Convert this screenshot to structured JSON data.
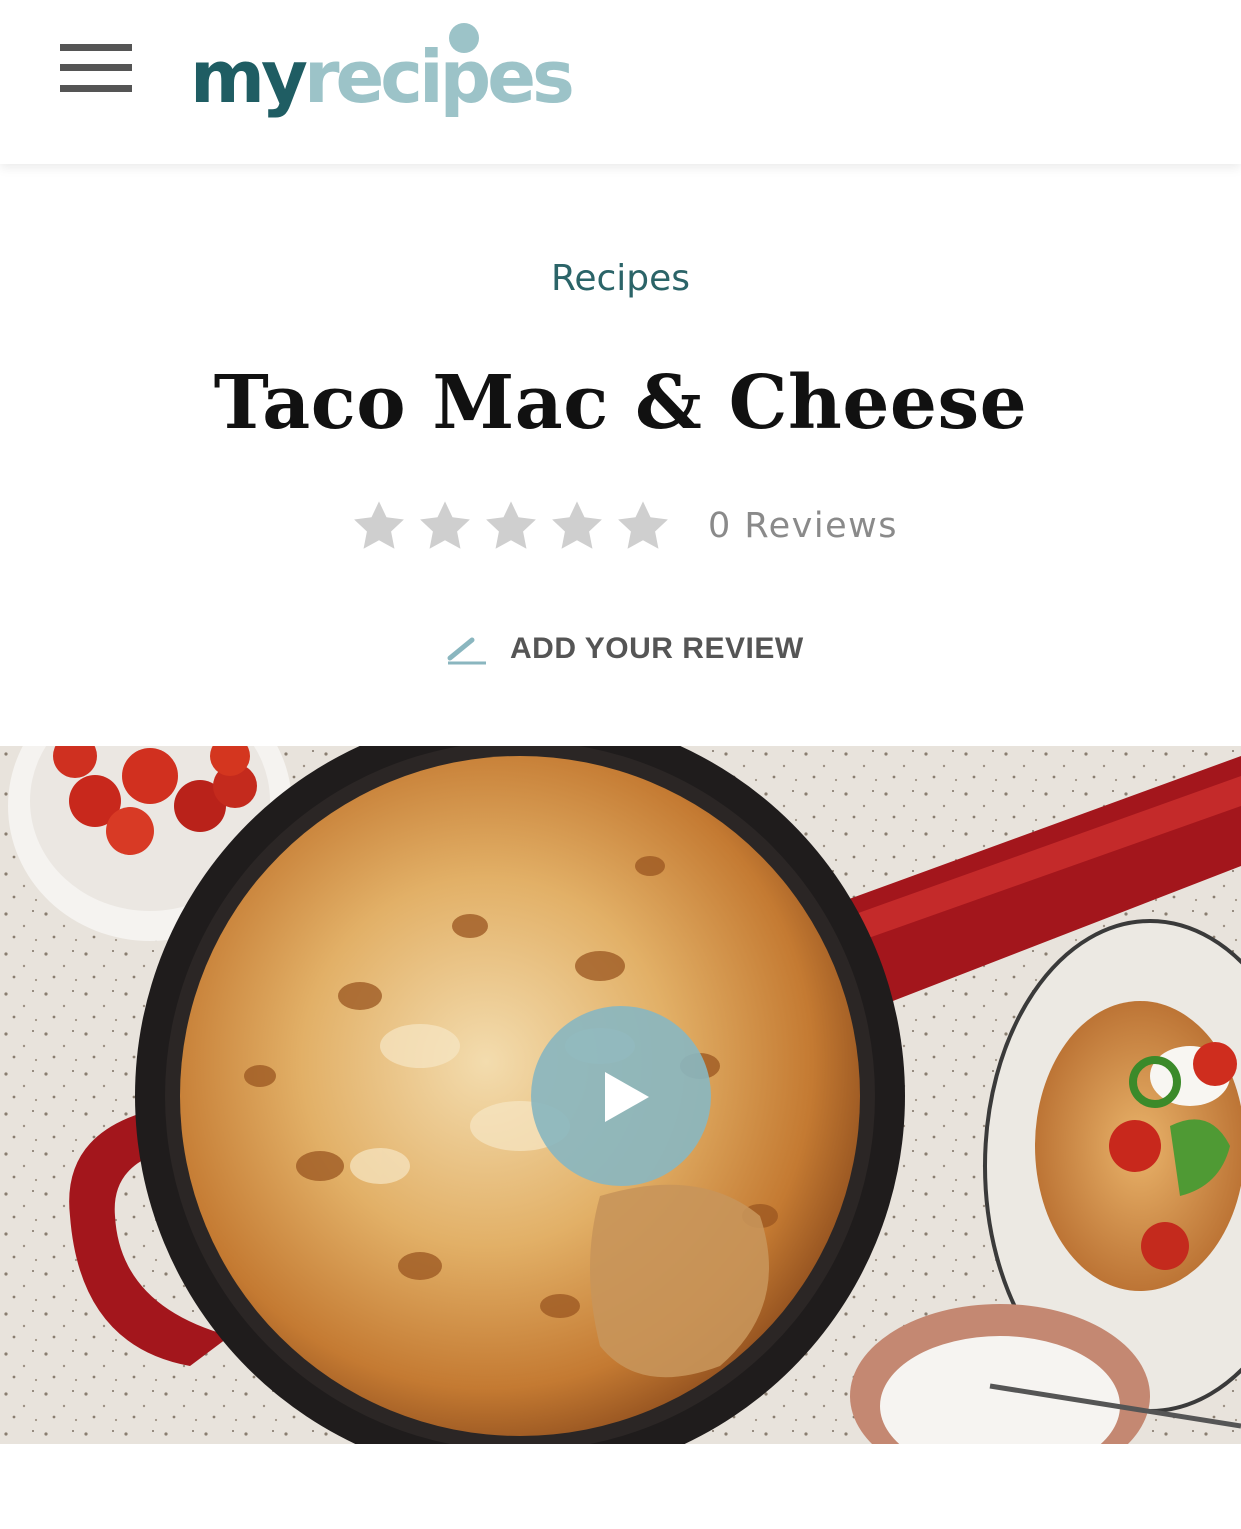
{
  "header": {
    "menu_icon": "hamburger-menu-icon",
    "logo": {
      "part1": "my",
      "part2": "recipes",
      "color_dark": "#1f5d63",
      "color_light": "#9cc3c8"
    }
  },
  "breadcrumb": "Recipes",
  "title": "Taco Mac & Cheese",
  "rating": {
    "stars_total": 5,
    "stars_filled": 0,
    "reviews_label": "0 Reviews",
    "star_color_empty": "#cfcfcf"
  },
  "add_review": {
    "icon": "pencil-icon",
    "label": "ADD YOUR REVIEW"
  },
  "hero": {
    "play_icon": "play-icon",
    "play_color": "#8ab6bf"
  },
  "colors": {
    "accent": "#2b6468",
    "text": "#111111",
    "muted": "#8a8a8a"
  }
}
